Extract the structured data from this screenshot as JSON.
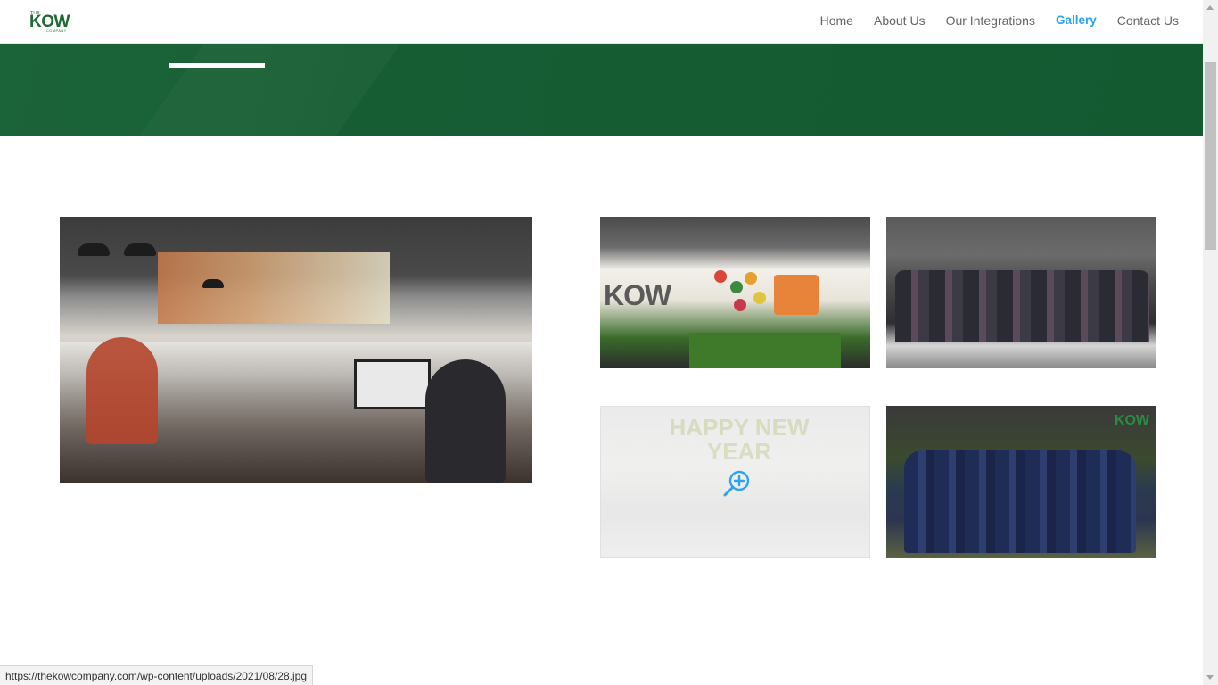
{
  "logo": {
    "the": "THE",
    "name": "KOW",
    "company": "COMPANY"
  },
  "nav": {
    "items": [
      {
        "label": "Home"
      },
      {
        "label": "About Us"
      },
      {
        "label": "Our Integrations"
      },
      {
        "label": "Gallery",
        "active": true
      },
      {
        "label": "Contact Us"
      }
    ]
  },
  "gallery": {
    "stage_logo": "KOW",
    "newyear_text": "HAPPY NEW YEAR",
    "sports_logo": "KOW"
  },
  "status_url": "https://thekowcompany.com/wp-content/uploads/2021/08/28.jpg",
  "colors": {
    "banner": "#135a31",
    "nav_active": "#2ea3f2",
    "nav_text": "#666666",
    "zoom_icon": "#2ea3f2"
  }
}
